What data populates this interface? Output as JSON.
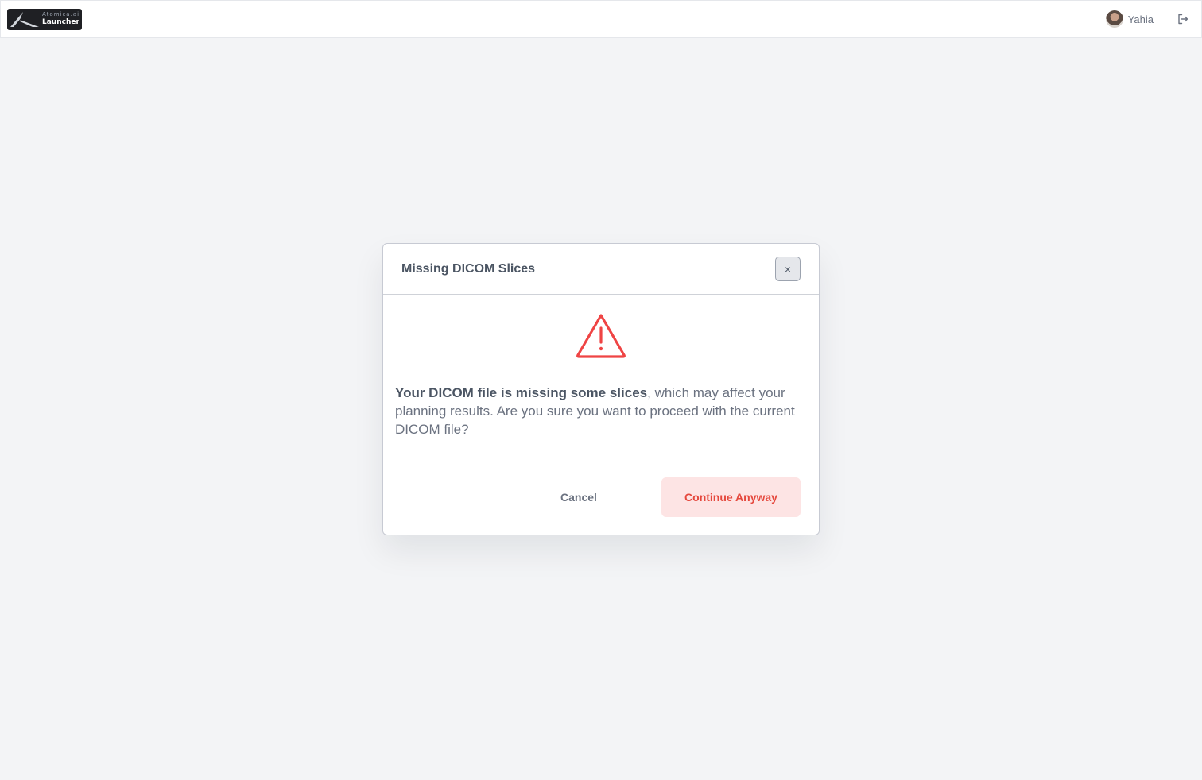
{
  "app": {
    "logo_top": "Atomica.ai",
    "logo_bottom": "Launcher"
  },
  "user": {
    "name": "Yahia"
  },
  "dialog": {
    "title": "Missing DICOM Slices",
    "close_label": "×",
    "message_bold": "Your DICOM file is missing some slices",
    "message_rest": ", which may affect your planning results. Are you sure you want to proceed with the current DICOM file?",
    "cancel_label": "Cancel",
    "continue_label": "Continue Anyway"
  },
  "colors": {
    "warning": "#ef4444",
    "continue_bg": "#fde4e4",
    "continue_text": "#e5483d"
  },
  "icons": {
    "warning": "warning-triangle-icon",
    "close": "close-icon",
    "logout": "logout-icon"
  }
}
